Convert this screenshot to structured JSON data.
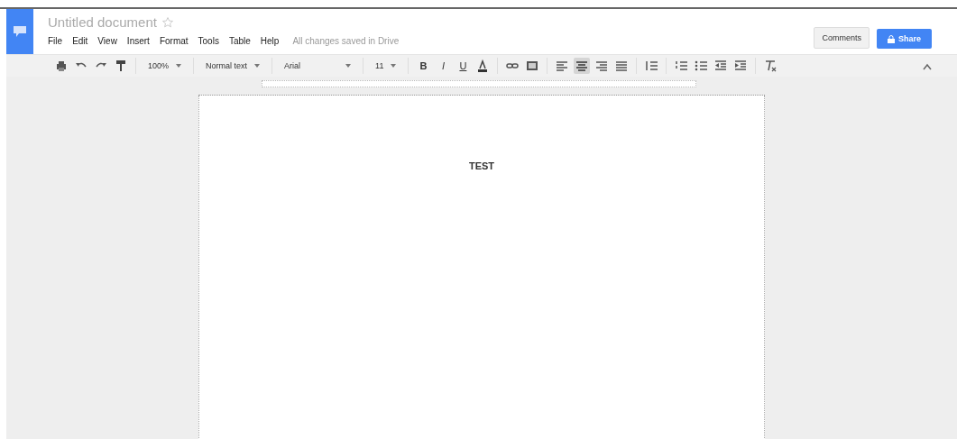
{
  "document": {
    "title": "Untitled document",
    "starred": false
  },
  "menu": [
    "File",
    "Edit",
    "View",
    "Insert",
    "Format",
    "Tools",
    "Table",
    "Help"
  ],
  "save_status": "All changes saved in Drive",
  "buttons": {
    "comments": "Comments",
    "share": "Share"
  },
  "toolbar": [
    {
      "kind": "print"
    },
    {
      "kind": "undo"
    },
    {
      "kind": "redo"
    },
    {
      "kind": "paint"
    },
    {
      "kind": "sep"
    },
    {
      "kind": "dropdown",
      "value": "100%"
    },
    {
      "kind": "sep"
    },
    {
      "kind": "dropdown",
      "value": "Normal text"
    },
    {
      "kind": "sep"
    },
    {
      "kind": "fontmenu",
      "value": "Arial"
    },
    {
      "kind": "sep"
    },
    {
      "kind": "dropdown",
      "value": "11"
    },
    {
      "kind": "sep"
    },
    {
      "kind": "bold",
      "value": "B"
    },
    {
      "kind": "italic",
      "value": "I"
    },
    {
      "kind": "underline",
      "value": "U"
    },
    {
      "kind": "color"
    },
    {
      "kind": "sep"
    },
    {
      "kind": "link"
    },
    {
      "kind": "comment"
    },
    {
      "kind": "sep"
    },
    {
      "kind": "left",
      "selected": false
    },
    {
      "kind": "center",
      "selected": true
    },
    {
      "kind": "right",
      "selected": false
    },
    {
      "kind": "justify",
      "selected": false
    },
    {
      "kind": "sep"
    },
    {
      "kind": "spacing"
    },
    {
      "kind": "sep"
    },
    {
      "kind": "numbered"
    },
    {
      "kind": "bulleted"
    },
    {
      "kind": "outdent"
    },
    {
      "kind": "indent"
    },
    {
      "kind": "sep"
    },
    {
      "kind": "clear"
    }
  ],
  "body": "TEST"
}
